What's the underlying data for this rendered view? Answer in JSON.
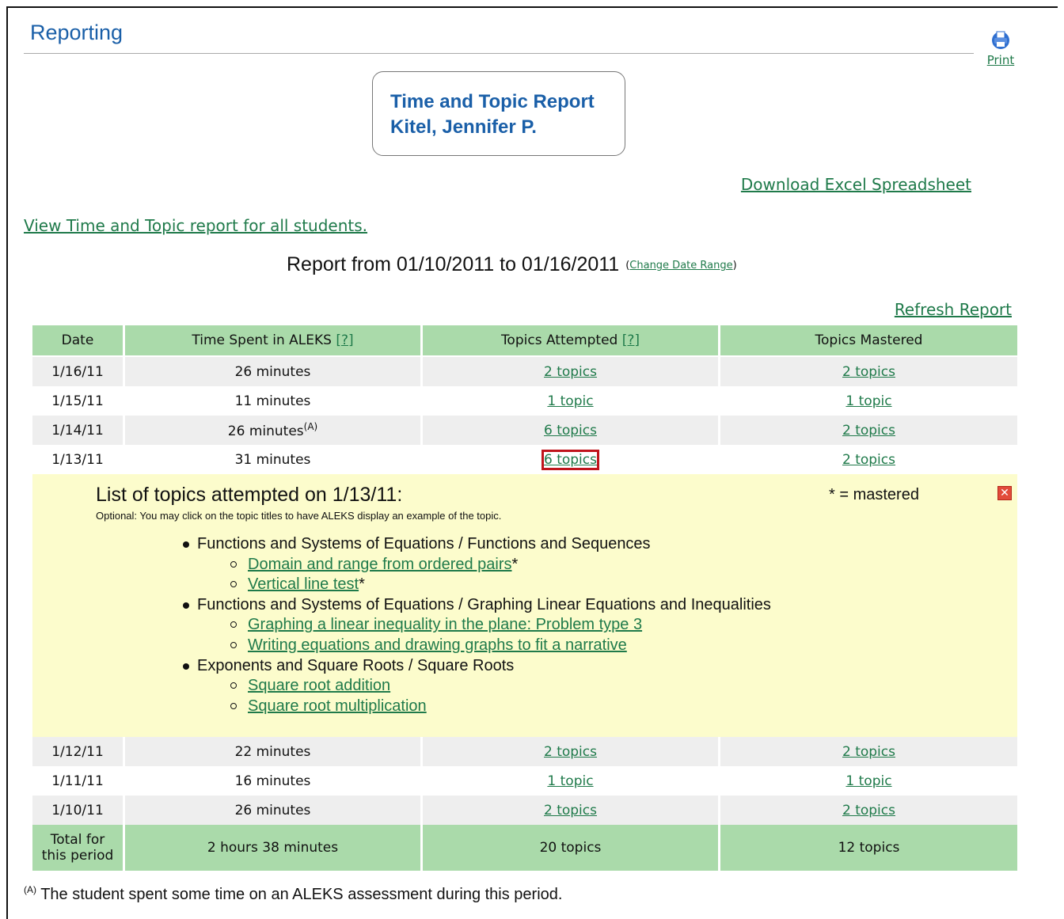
{
  "header": {
    "title": "Reporting",
    "print_label": "Print"
  },
  "report_box": {
    "report_name": "Time and Topic Report",
    "student_name": "Kitel, Jennifer P."
  },
  "links": {
    "download": "Download Excel Spreadsheet",
    "view_all": "View Time and Topic report for all students.",
    "refresh": "Refresh Report"
  },
  "range": {
    "text": "Report from 01/10/2011 to 01/16/2011",
    "change_paren_open": "(",
    "change_label": "Change Date Range",
    "change_paren_close": ")"
  },
  "table": {
    "headers": {
      "date": "Date",
      "time": "Time Spent in ALEKS",
      "help": "[?]",
      "attempted": "Topics Attempted",
      "mastered": "Topics Mastered"
    },
    "rows": [
      {
        "date": "1/16/11",
        "time": "26 minutes",
        "note": "",
        "attempted": "2 topics",
        "mastered": "2 topics"
      },
      {
        "date": "1/15/11",
        "time": "11 minutes",
        "note": "",
        "attempted": "1 topic",
        "mastered": "1 topic"
      },
      {
        "date": "1/14/11",
        "time": "26 minutes",
        "note": "(A)",
        "attempted": "6 topics",
        "mastered": "2 topics"
      },
      {
        "date": "1/13/11",
        "time": "31 minutes",
        "note": "",
        "attempted": "6 topics",
        "mastered": "2 topics"
      },
      {
        "date": "1/12/11",
        "time": "22 minutes",
        "note": "",
        "attempted": "2 topics",
        "mastered": "2 topics"
      },
      {
        "date": "1/11/11",
        "time": "16 minutes",
        "note": "",
        "attempted": "1 topic",
        "mastered": "1 topic"
      },
      {
        "date": "1/10/11",
        "time": "26 minutes",
        "note": "",
        "attempted": "2 topics",
        "mastered": "2 topics"
      }
    ],
    "total": {
      "label_line1": "Total for",
      "label_line2": "this period",
      "time": "2 hours 38 minutes",
      "attempted": "20 topics",
      "mastered": "12 topics"
    }
  },
  "detail": {
    "title": "List of topics attempted on 1/13/11:",
    "subtitle": "Optional: You may click on the topic titles to have ALEKS display an example of the topic.",
    "legend": "* = mastered",
    "categories": [
      {
        "name": "Functions and Systems of Equations / Functions and Sequences",
        "topics": [
          {
            "name": "Domain and range from ordered pairs",
            "mark": "*"
          },
          {
            "name": "Vertical line test",
            "mark": "*"
          }
        ]
      },
      {
        "name": "Functions and Systems of Equations / Graphing Linear Equations and Inequalities",
        "topics": [
          {
            "name": "Graphing a linear inequality in the plane: Problem type 3",
            "mark": ""
          },
          {
            "name": "Writing equations and drawing graphs to fit a narrative",
            "mark": ""
          }
        ]
      },
      {
        "name": "Exponents and Square Roots / Square Roots",
        "topics": [
          {
            "name": "Square root addition",
            "mark": ""
          },
          {
            "name": "Square root multiplication",
            "mark": ""
          }
        ]
      }
    ]
  },
  "footnote": {
    "mark": "(A)",
    "text": " The student spent some time on an ALEKS assessment during this period."
  },
  "colors": {
    "header_green": "#aadaaa",
    "title_blue": "#1a5fa8",
    "link_green": "#1f7a4a",
    "detail_yellow": "#fcfccc",
    "highlight_red": "#c0141c"
  },
  "icons": {
    "print": "printer-icon",
    "close": "close-icon"
  }
}
